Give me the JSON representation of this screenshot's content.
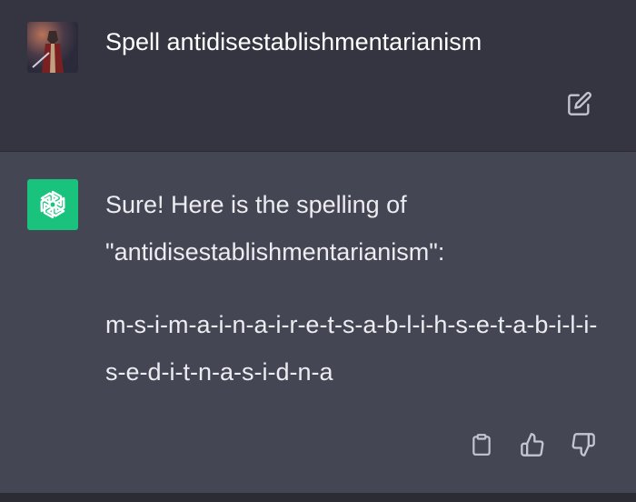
{
  "conversation": {
    "user": {
      "avatar_icon": "user-avatar",
      "message": "Spell antidisestablishmentarianism",
      "edit_icon": "edit-icon"
    },
    "assistant": {
      "avatar_icon": "openai-logo-icon",
      "avatar_color": "#19c37d",
      "line1": "Sure! Here is the spelling of",
      "line2": "\"antidisestablishmentarianism\":",
      "spelling": "m-s-i-m-a-i-n-a-i-r-e-t-s-a-b-l-i-h-s-e-t-a-b-i-l-i-s-e-d-i-t-n-a-s-i-d-n-a",
      "actions": [
        "copy-icon",
        "thumbs-up-icon",
        "thumbs-down-icon"
      ]
    }
  },
  "colors": {
    "user_bg": "#343541",
    "assistant_bg": "#444654",
    "text": "#ececf1",
    "icon": "#c5c5d2"
  }
}
